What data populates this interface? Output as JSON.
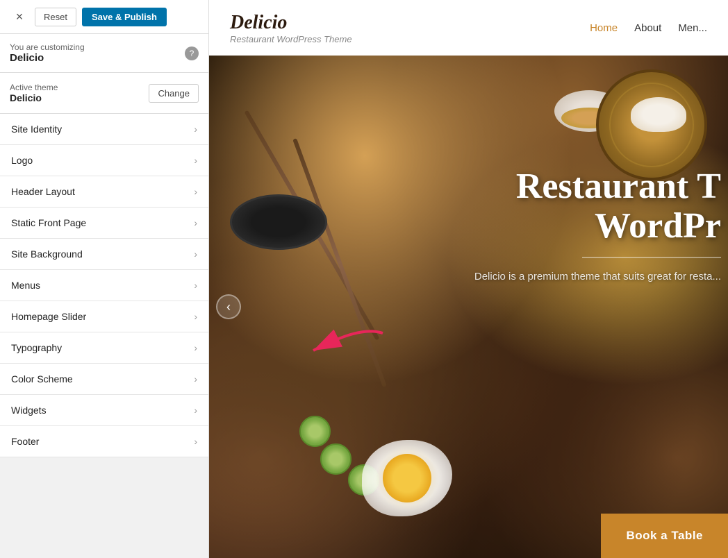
{
  "header": {
    "close_label": "×",
    "reset_label": "Reset",
    "save_label": "Save & Publish"
  },
  "customizing": {
    "prefix": "You are customizing",
    "theme_name": "Delicio",
    "help_icon": "?"
  },
  "active_theme": {
    "label": "Active theme",
    "name": "Delicio",
    "change_label": "Change"
  },
  "menu_items": [
    {
      "id": "site-identity",
      "label": "Site Identity"
    },
    {
      "id": "logo",
      "label": "Logo"
    },
    {
      "id": "header-layout",
      "label": "Header Layout"
    },
    {
      "id": "static-front-page",
      "label": "Static Front Page"
    },
    {
      "id": "site-background",
      "label": "Site Background"
    },
    {
      "id": "menus",
      "label": "Menus"
    },
    {
      "id": "homepage-slider",
      "label": "Homepage Slider",
      "active": true
    },
    {
      "id": "typography",
      "label": "Typography"
    },
    {
      "id": "color-scheme",
      "label": "Color Scheme"
    },
    {
      "id": "widgets",
      "label": "Widgets"
    },
    {
      "id": "footer",
      "label": "Footer"
    }
  ],
  "preview": {
    "site_title": "Delicio",
    "tagline": "Restaurant WordPress Theme",
    "nav_items": [
      "Home",
      "About",
      "Menu"
    ],
    "nav_active": "Home",
    "hero_heading_line1": "Restaurant T",
    "hero_heading_line2": "WordPr",
    "hero_subtext": "Delicio is a premium theme that suits great for resta...",
    "book_table_label": "Book a Table",
    "slider_prev": "‹"
  }
}
